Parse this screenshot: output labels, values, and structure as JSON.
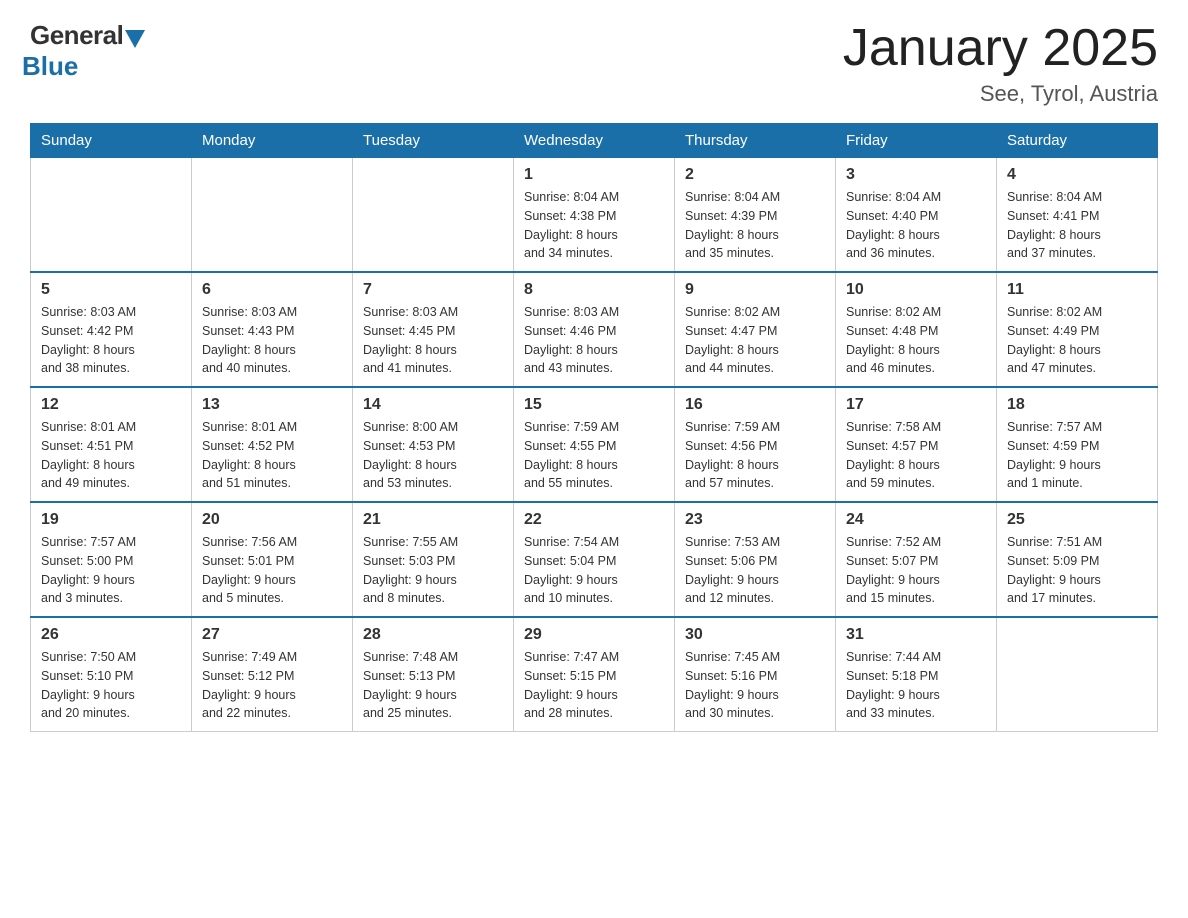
{
  "logo": {
    "general": "General",
    "blue": "Blue"
  },
  "title": {
    "month": "January 2025",
    "location": "See, Tyrol, Austria"
  },
  "weekdays": [
    "Sunday",
    "Monday",
    "Tuesday",
    "Wednesday",
    "Thursday",
    "Friday",
    "Saturday"
  ],
  "weeks": [
    [
      {
        "day": "",
        "info": ""
      },
      {
        "day": "",
        "info": ""
      },
      {
        "day": "",
        "info": ""
      },
      {
        "day": "1",
        "info": "Sunrise: 8:04 AM\nSunset: 4:38 PM\nDaylight: 8 hours\nand 34 minutes."
      },
      {
        "day": "2",
        "info": "Sunrise: 8:04 AM\nSunset: 4:39 PM\nDaylight: 8 hours\nand 35 minutes."
      },
      {
        "day": "3",
        "info": "Sunrise: 8:04 AM\nSunset: 4:40 PM\nDaylight: 8 hours\nand 36 minutes."
      },
      {
        "day": "4",
        "info": "Sunrise: 8:04 AM\nSunset: 4:41 PM\nDaylight: 8 hours\nand 37 minutes."
      }
    ],
    [
      {
        "day": "5",
        "info": "Sunrise: 8:03 AM\nSunset: 4:42 PM\nDaylight: 8 hours\nand 38 minutes."
      },
      {
        "day": "6",
        "info": "Sunrise: 8:03 AM\nSunset: 4:43 PM\nDaylight: 8 hours\nand 40 minutes."
      },
      {
        "day": "7",
        "info": "Sunrise: 8:03 AM\nSunset: 4:45 PM\nDaylight: 8 hours\nand 41 minutes."
      },
      {
        "day": "8",
        "info": "Sunrise: 8:03 AM\nSunset: 4:46 PM\nDaylight: 8 hours\nand 43 minutes."
      },
      {
        "day": "9",
        "info": "Sunrise: 8:02 AM\nSunset: 4:47 PM\nDaylight: 8 hours\nand 44 minutes."
      },
      {
        "day": "10",
        "info": "Sunrise: 8:02 AM\nSunset: 4:48 PM\nDaylight: 8 hours\nand 46 minutes."
      },
      {
        "day": "11",
        "info": "Sunrise: 8:02 AM\nSunset: 4:49 PM\nDaylight: 8 hours\nand 47 minutes."
      }
    ],
    [
      {
        "day": "12",
        "info": "Sunrise: 8:01 AM\nSunset: 4:51 PM\nDaylight: 8 hours\nand 49 minutes."
      },
      {
        "day": "13",
        "info": "Sunrise: 8:01 AM\nSunset: 4:52 PM\nDaylight: 8 hours\nand 51 minutes."
      },
      {
        "day": "14",
        "info": "Sunrise: 8:00 AM\nSunset: 4:53 PM\nDaylight: 8 hours\nand 53 minutes."
      },
      {
        "day": "15",
        "info": "Sunrise: 7:59 AM\nSunset: 4:55 PM\nDaylight: 8 hours\nand 55 minutes."
      },
      {
        "day": "16",
        "info": "Sunrise: 7:59 AM\nSunset: 4:56 PM\nDaylight: 8 hours\nand 57 minutes."
      },
      {
        "day": "17",
        "info": "Sunrise: 7:58 AM\nSunset: 4:57 PM\nDaylight: 8 hours\nand 59 minutes."
      },
      {
        "day": "18",
        "info": "Sunrise: 7:57 AM\nSunset: 4:59 PM\nDaylight: 9 hours\nand 1 minute."
      }
    ],
    [
      {
        "day": "19",
        "info": "Sunrise: 7:57 AM\nSunset: 5:00 PM\nDaylight: 9 hours\nand 3 minutes."
      },
      {
        "day": "20",
        "info": "Sunrise: 7:56 AM\nSunset: 5:01 PM\nDaylight: 9 hours\nand 5 minutes."
      },
      {
        "day": "21",
        "info": "Sunrise: 7:55 AM\nSunset: 5:03 PM\nDaylight: 9 hours\nand 8 minutes."
      },
      {
        "day": "22",
        "info": "Sunrise: 7:54 AM\nSunset: 5:04 PM\nDaylight: 9 hours\nand 10 minutes."
      },
      {
        "day": "23",
        "info": "Sunrise: 7:53 AM\nSunset: 5:06 PM\nDaylight: 9 hours\nand 12 minutes."
      },
      {
        "day": "24",
        "info": "Sunrise: 7:52 AM\nSunset: 5:07 PM\nDaylight: 9 hours\nand 15 minutes."
      },
      {
        "day": "25",
        "info": "Sunrise: 7:51 AM\nSunset: 5:09 PM\nDaylight: 9 hours\nand 17 minutes."
      }
    ],
    [
      {
        "day": "26",
        "info": "Sunrise: 7:50 AM\nSunset: 5:10 PM\nDaylight: 9 hours\nand 20 minutes."
      },
      {
        "day": "27",
        "info": "Sunrise: 7:49 AM\nSunset: 5:12 PM\nDaylight: 9 hours\nand 22 minutes."
      },
      {
        "day": "28",
        "info": "Sunrise: 7:48 AM\nSunset: 5:13 PM\nDaylight: 9 hours\nand 25 minutes."
      },
      {
        "day": "29",
        "info": "Sunrise: 7:47 AM\nSunset: 5:15 PM\nDaylight: 9 hours\nand 28 minutes."
      },
      {
        "day": "30",
        "info": "Sunrise: 7:45 AM\nSunset: 5:16 PM\nDaylight: 9 hours\nand 30 minutes."
      },
      {
        "day": "31",
        "info": "Sunrise: 7:44 AM\nSunset: 5:18 PM\nDaylight: 9 hours\nand 33 minutes."
      },
      {
        "day": "",
        "info": ""
      }
    ]
  ]
}
